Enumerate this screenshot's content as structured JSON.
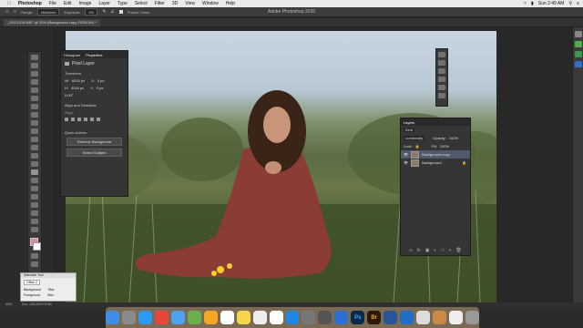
{
  "menubar": {
    "app": "Photoshop",
    "items": [
      "File",
      "Edit",
      "Image",
      "Layer",
      "Type",
      "Select",
      "Filter",
      "3D",
      "View",
      "Window",
      "Help"
    ],
    "time": "Sun 2:49 AM"
  },
  "app_title": "Adobe Photoshop 2020",
  "options": {
    "range_label": "Range:",
    "range_value": "Midtones",
    "exposure_label": "Exposure:",
    "exposure_value": "9%",
    "protect_tones": "Protect Tones"
  },
  "document_tab": "_DSC1028.NEF @ 33% (Background copy, RGB/16*) *",
  "properties": {
    "tab_histogram": "Histogram",
    "tab_properties": "Properties",
    "layer_type": "Pixel Layer",
    "transform": "Transform",
    "w_label": "W:",
    "w_value": "6016 px",
    "h_label": "H:",
    "h_value": "4016 px",
    "x_label": "X:",
    "x_value": "0 px",
    "y_label": "Y:",
    "y_value": "0 px",
    "angle": "0.00°",
    "align_heading": "Align and Distribute",
    "align_label": "Align:",
    "quick_actions": "Quick Actions",
    "remove_background": "Remove Background",
    "select_subject": "Select Subject"
  },
  "layers": {
    "title": "Layers",
    "kind": "Kind",
    "blend": "Luminosity",
    "opacity_label": "Opacity:",
    "opacity_value": "100%",
    "lock_label": "Lock:",
    "fill_label": "Fill:",
    "fill_value": "100%",
    "rows": [
      {
        "name": "Background copy",
        "selected": true
      },
      {
        "name": "Background",
        "selected": false
      }
    ]
  },
  "status": {
    "zoom": "33%",
    "doc": "Doc: 138.2M/276.5M"
  },
  "popup": {
    "title": "Selective Tool",
    "field1": "Office 2",
    "field2": "Office 2",
    "row2a": "Background",
    "row2b": "Skin",
    "row3a": "Foreground",
    "row3b": "Skin"
  },
  "dock": {
    "ps_label": "Ps",
    "br_label": "Br"
  },
  "colors": {
    "accent": "#2d72c8",
    "dress": "#8b3d35",
    "panel": "#353535"
  }
}
